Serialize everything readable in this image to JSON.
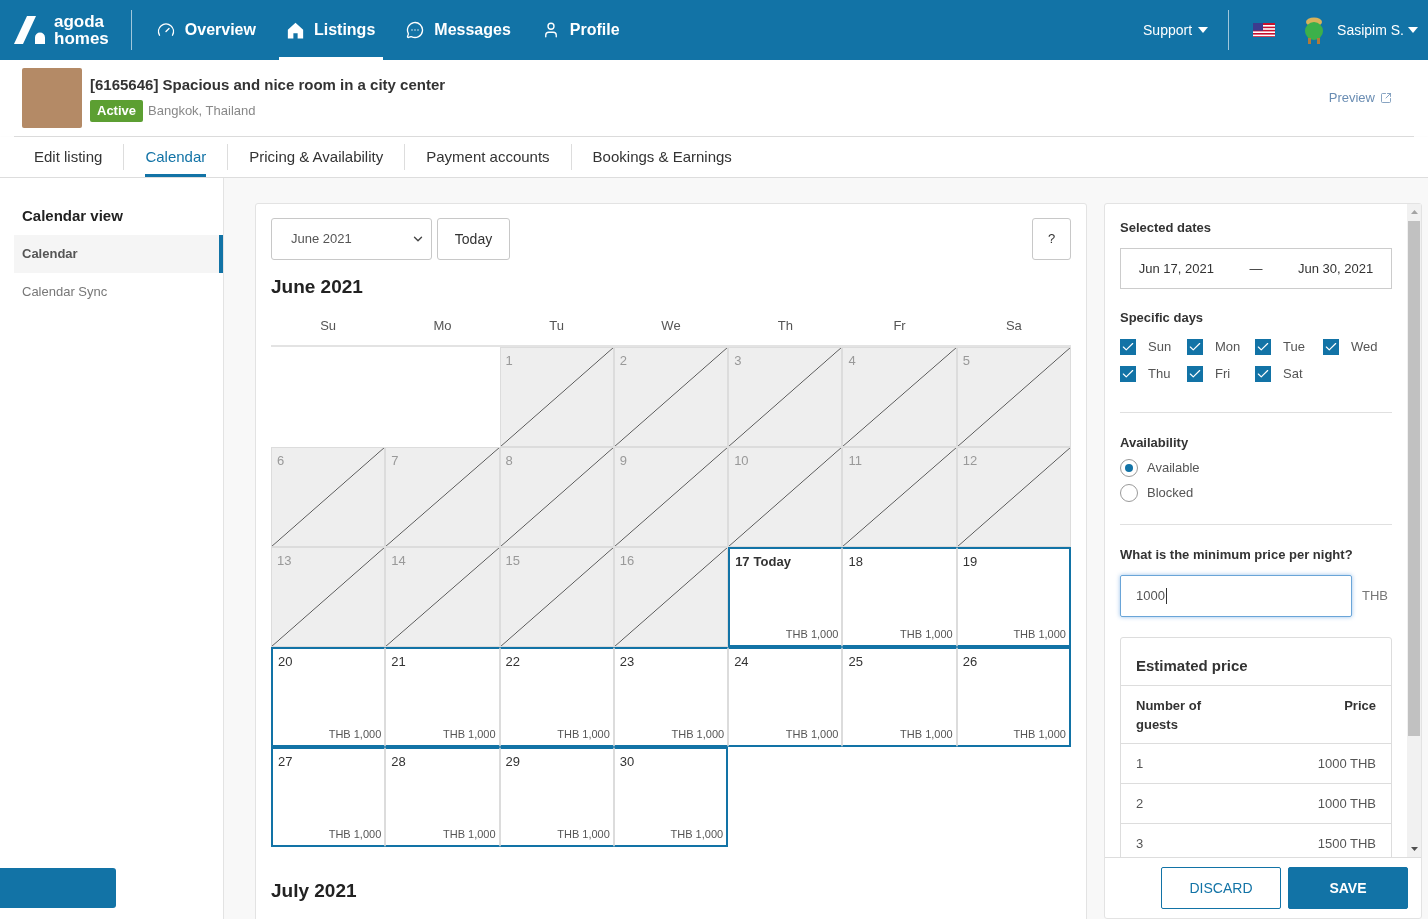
{
  "header": {
    "logo": {
      "top": "agoda",
      "bottom": "homes"
    },
    "nav": [
      {
        "label": "Overview",
        "selected": false
      },
      {
        "label": "Listings",
        "selected": true
      },
      {
        "label": "Messages",
        "selected": false
      },
      {
        "label": "Profile",
        "selected": false
      }
    ],
    "support": "Support",
    "user": "Sasipim S."
  },
  "listing": {
    "title": "[6165646] Spacious and nice room in a city center",
    "status": "Active",
    "location": "Bangkok, Thailand",
    "preview": "Preview"
  },
  "tabs": [
    {
      "label": "Edit listing",
      "selected": false
    },
    {
      "label": "Calendar",
      "selected": true
    },
    {
      "label": "Pricing & Availability",
      "selected": false
    },
    {
      "label": "Payment accounts",
      "selected": false
    },
    {
      "label": "Bookings & Earnings",
      "selected": false
    }
  ],
  "sidebar": {
    "title": "Calendar view",
    "items": [
      {
        "label": "Calendar",
        "selected": true
      },
      {
        "label": "Calendar Sync",
        "selected": false
      }
    ]
  },
  "calendar": {
    "month_select": "June 2021",
    "today_button": "Today",
    "help_button": "?",
    "month_title": "June 2021",
    "weekdays": [
      "Su",
      "Mo",
      "Tu",
      "We",
      "Th",
      "Fr",
      "Sa"
    ],
    "weeks": [
      {
        "days": [
          {
            "kind": "empty"
          },
          {
            "kind": "empty"
          },
          {
            "kind": "past",
            "number": "1",
            "selected": false
          },
          {
            "kind": "past",
            "number": "2",
            "selected": false
          },
          {
            "kind": "past",
            "number": "3",
            "selected": false
          },
          {
            "kind": "past",
            "number": "4",
            "selected": false
          },
          {
            "kind": "past",
            "number": "5",
            "selected": false
          }
        ]
      },
      {
        "days": [
          {
            "kind": "past",
            "number": "6",
            "selected": false
          },
          {
            "kind": "past",
            "number": "7",
            "selected": false
          },
          {
            "kind": "past",
            "number": "8",
            "selected": false
          },
          {
            "kind": "past",
            "number": "9",
            "selected": false
          },
          {
            "kind": "past",
            "number": "10",
            "selected": false
          },
          {
            "kind": "past",
            "number": "11",
            "selected": false
          },
          {
            "kind": "past",
            "number": "12",
            "selected": false
          }
        ]
      },
      {
        "days": [
          {
            "kind": "past",
            "number": "13",
            "selected": false
          },
          {
            "kind": "past",
            "number": "14",
            "selected": false
          },
          {
            "kind": "past",
            "number": "15",
            "selected": false
          },
          {
            "kind": "past",
            "number": "16",
            "selected": false
          },
          {
            "kind": "today",
            "number": "17",
            "note": "Today",
            "price": "THB 1,000",
            "selected": true
          },
          {
            "kind": "open",
            "number": "18",
            "price": "THB 1,000",
            "selected": true
          },
          {
            "kind": "open",
            "number": "19",
            "price": "THB 1,000",
            "selected": true
          }
        ]
      },
      {
        "days": [
          {
            "kind": "open",
            "number": "20",
            "price": "THB 1,000",
            "selected": true
          },
          {
            "kind": "open",
            "number": "21",
            "price": "THB 1,000",
            "selected": true
          },
          {
            "kind": "open",
            "number": "22",
            "price": "THB 1,000",
            "selected": true
          },
          {
            "kind": "open",
            "number": "23",
            "price": "THB 1,000",
            "selected": true
          },
          {
            "kind": "open",
            "number": "24",
            "price": "THB 1,000",
            "selected": true
          },
          {
            "kind": "open",
            "number": "25",
            "price": "THB 1,000",
            "selected": true
          },
          {
            "kind": "open",
            "number": "26",
            "price": "THB 1,000",
            "selected": true
          }
        ]
      },
      {
        "days": [
          {
            "kind": "open",
            "number": "27",
            "price": "THB 1,000",
            "selected": true
          },
          {
            "kind": "open",
            "number": "28",
            "price": "THB 1,000",
            "selected": true
          },
          {
            "kind": "open",
            "number": "29",
            "price": "THB 1,000",
            "selected": true
          },
          {
            "kind": "open",
            "number": "30",
            "price": "THB 1,000",
            "selected": true
          },
          {
            "kind": "empty"
          },
          {
            "kind": "empty"
          },
          {
            "kind": "empty"
          }
        ]
      }
    ],
    "next_month_title": "July 2021"
  },
  "panel": {
    "selected_dates": {
      "label": "Selected dates",
      "start": "Jun 17, 2021",
      "separator": "—",
      "end": "Jun 30, 2021"
    },
    "specific_days": {
      "label": "Specific days",
      "days": [
        {
          "label": "Sun",
          "checked": true
        },
        {
          "label": "Mon",
          "checked": true
        },
        {
          "label": "Tue",
          "checked": true
        },
        {
          "label": "Wed",
          "checked": true
        },
        {
          "label": "Thu",
          "checked": true
        },
        {
          "label": "Fri",
          "checked": true
        },
        {
          "label": "Sat",
          "checked": true
        }
      ]
    },
    "availability": {
      "label": "Availability",
      "options": [
        {
          "label": "Available",
          "selected": true
        },
        {
          "label": "Blocked",
          "selected": false
        }
      ]
    },
    "min_price": {
      "label": "What is the minimum price per night?",
      "value": "1000",
      "currency": "THB",
      "focused": true
    },
    "estimated_price": {
      "title": "Estimated price",
      "columns": [
        "Number of guests",
        "Price"
      ],
      "rows": [
        {
          "guests": "1",
          "price": "1000 THB"
        },
        {
          "guests": "2",
          "price": "1000 THB"
        },
        {
          "guests": "3",
          "price": "1500 THB"
        }
      ]
    },
    "buttons": [
      {
        "label": "DISCARD",
        "kind": "secondary"
      },
      {
        "label": "SAVE",
        "kind": "primary"
      }
    ]
  }
}
